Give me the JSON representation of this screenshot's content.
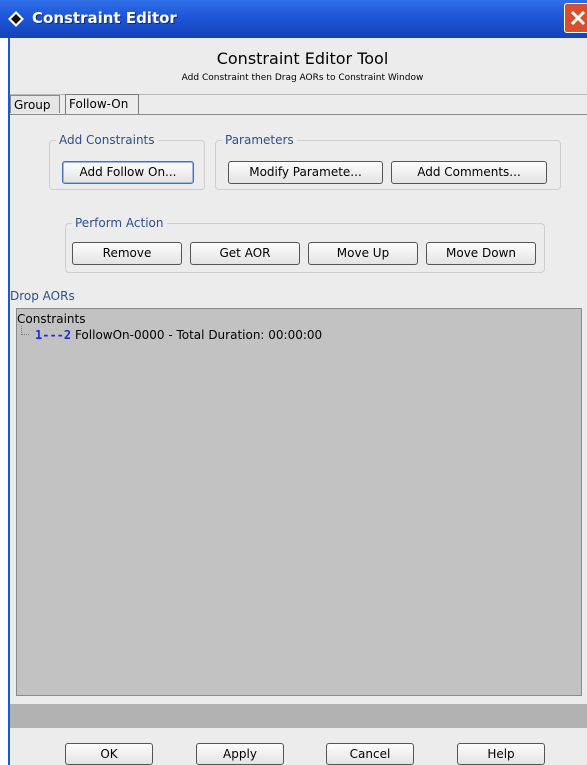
{
  "window": {
    "title": "Constraint Editor",
    "close_icon": "close-icon",
    "app_icon": "diamond-logo-icon",
    "accent": "#1d56d8",
    "close_color": "#d7502e"
  },
  "header": {
    "title": "Constraint Editor Tool",
    "subtitle": "Add Constraint then Drag AORs to Constraint Window"
  },
  "tabs": [
    {
      "label": "Group",
      "active": false
    },
    {
      "label": "Follow-On",
      "active": true
    }
  ],
  "add_constraints": {
    "legend": "Add Constraints",
    "add_follow_on": "Add Follow On..."
  },
  "parameters": {
    "legend": "Parameters",
    "modify": "Modify Paramete...",
    "add_comments": "Add Comments..."
  },
  "perform_action": {
    "legend": "Perform Action",
    "remove": "Remove",
    "get_aor": "Get AOR",
    "move_up": "Move Up",
    "move_down": "Move Down"
  },
  "drop_aors": {
    "label": "Drop AORs",
    "tree": {
      "root": "Constraints",
      "items": [
        {
          "id": "1---2",
          "text": "FollowOn-0000 - Total Duration: 00:00:00"
        }
      ]
    },
    "background": "#c2c2c2"
  },
  "footer": {
    "ok": "OK",
    "apply": "Apply",
    "cancel": "Cancel",
    "help": "Help"
  }
}
